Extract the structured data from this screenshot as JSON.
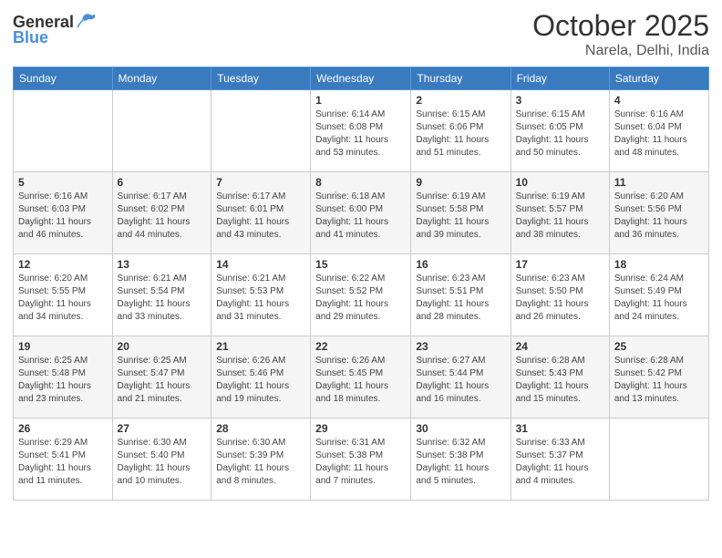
{
  "header": {
    "logo_general": "General",
    "logo_blue": "Blue",
    "month_title": "October 2025",
    "location": "Narela, Delhi, India"
  },
  "weekdays": [
    "Sunday",
    "Monday",
    "Tuesday",
    "Wednesday",
    "Thursday",
    "Friday",
    "Saturday"
  ],
  "weeks": [
    [
      {
        "day": "",
        "info": ""
      },
      {
        "day": "",
        "info": ""
      },
      {
        "day": "",
        "info": ""
      },
      {
        "day": "1",
        "info": "Sunrise: 6:14 AM\nSunset: 6:08 PM\nDaylight: 11 hours\nand 53 minutes."
      },
      {
        "day": "2",
        "info": "Sunrise: 6:15 AM\nSunset: 6:06 PM\nDaylight: 11 hours\nand 51 minutes."
      },
      {
        "day": "3",
        "info": "Sunrise: 6:15 AM\nSunset: 6:05 PM\nDaylight: 11 hours\nand 50 minutes."
      },
      {
        "day": "4",
        "info": "Sunrise: 6:16 AM\nSunset: 6:04 PM\nDaylight: 11 hours\nand 48 minutes."
      }
    ],
    [
      {
        "day": "5",
        "info": "Sunrise: 6:16 AM\nSunset: 6:03 PM\nDaylight: 11 hours\nand 46 minutes."
      },
      {
        "day": "6",
        "info": "Sunrise: 6:17 AM\nSunset: 6:02 PM\nDaylight: 11 hours\nand 44 minutes."
      },
      {
        "day": "7",
        "info": "Sunrise: 6:17 AM\nSunset: 6:01 PM\nDaylight: 11 hours\nand 43 minutes."
      },
      {
        "day": "8",
        "info": "Sunrise: 6:18 AM\nSunset: 6:00 PM\nDaylight: 11 hours\nand 41 minutes."
      },
      {
        "day": "9",
        "info": "Sunrise: 6:19 AM\nSunset: 5:58 PM\nDaylight: 11 hours\nand 39 minutes."
      },
      {
        "day": "10",
        "info": "Sunrise: 6:19 AM\nSunset: 5:57 PM\nDaylight: 11 hours\nand 38 minutes."
      },
      {
        "day": "11",
        "info": "Sunrise: 6:20 AM\nSunset: 5:56 PM\nDaylight: 11 hours\nand 36 minutes."
      }
    ],
    [
      {
        "day": "12",
        "info": "Sunrise: 6:20 AM\nSunset: 5:55 PM\nDaylight: 11 hours\nand 34 minutes."
      },
      {
        "day": "13",
        "info": "Sunrise: 6:21 AM\nSunset: 5:54 PM\nDaylight: 11 hours\nand 33 minutes."
      },
      {
        "day": "14",
        "info": "Sunrise: 6:21 AM\nSunset: 5:53 PM\nDaylight: 11 hours\nand 31 minutes."
      },
      {
        "day": "15",
        "info": "Sunrise: 6:22 AM\nSunset: 5:52 PM\nDaylight: 11 hours\nand 29 minutes."
      },
      {
        "day": "16",
        "info": "Sunrise: 6:23 AM\nSunset: 5:51 PM\nDaylight: 11 hours\nand 28 minutes."
      },
      {
        "day": "17",
        "info": "Sunrise: 6:23 AM\nSunset: 5:50 PM\nDaylight: 11 hours\nand 26 minutes."
      },
      {
        "day": "18",
        "info": "Sunrise: 6:24 AM\nSunset: 5:49 PM\nDaylight: 11 hours\nand 24 minutes."
      }
    ],
    [
      {
        "day": "19",
        "info": "Sunrise: 6:25 AM\nSunset: 5:48 PM\nDaylight: 11 hours\nand 23 minutes."
      },
      {
        "day": "20",
        "info": "Sunrise: 6:25 AM\nSunset: 5:47 PM\nDaylight: 11 hours\nand 21 minutes."
      },
      {
        "day": "21",
        "info": "Sunrise: 6:26 AM\nSunset: 5:46 PM\nDaylight: 11 hours\nand 19 minutes."
      },
      {
        "day": "22",
        "info": "Sunrise: 6:26 AM\nSunset: 5:45 PM\nDaylight: 11 hours\nand 18 minutes."
      },
      {
        "day": "23",
        "info": "Sunrise: 6:27 AM\nSunset: 5:44 PM\nDaylight: 11 hours\nand 16 minutes."
      },
      {
        "day": "24",
        "info": "Sunrise: 6:28 AM\nSunset: 5:43 PM\nDaylight: 11 hours\nand 15 minutes."
      },
      {
        "day": "25",
        "info": "Sunrise: 6:28 AM\nSunset: 5:42 PM\nDaylight: 11 hours\nand 13 minutes."
      }
    ],
    [
      {
        "day": "26",
        "info": "Sunrise: 6:29 AM\nSunset: 5:41 PM\nDaylight: 11 hours\nand 11 minutes."
      },
      {
        "day": "27",
        "info": "Sunrise: 6:30 AM\nSunset: 5:40 PM\nDaylight: 11 hours\nand 10 minutes."
      },
      {
        "day": "28",
        "info": "Sunrise: 6:30 AM\nSunset: 5:39 PM\nDaylight: 11 hours\nand 8 minutes."
      },
      {
        "day": "29",
        "info": "Sunrise: 6:31 AM\nSunset: 5:38 PM\nDaylight: 11 hours\nand 7 minutes."
      },
      {
        "day": "30",
        "info": "Sunrise: 6:32 AM\nSunset: 5:38 PM\nDaylight: 11 hours\nand 5 minutes."
      },
      {
        "day": "31",
        "info": "Sunrise: 6:33 AM\nSunset: 5:37 PM\nDaylight: 11 hours\nand 4 minutes."
      },
      {
        "day": "",
        "info": ""
      }
    ]
  ]
}
